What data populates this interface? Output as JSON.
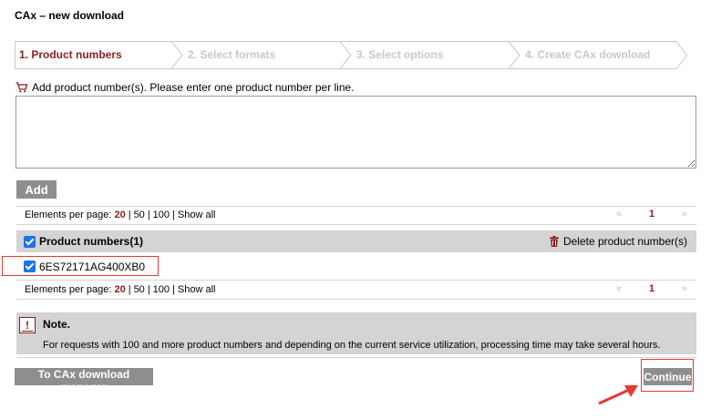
{
  "page": {
    "title": "CAx – new download"
  },
  "steps": [
    {
      "label": "1. Product numbers",
      "active": true
    },
    {
      "label": "2. Select formats",
      "active": false
    },
    {
      "label": "3. Select options",
      "active": false
    },
    {
      "label": "4. Create CAx download",
      "active": false
    }
  ],
  "entry": {
    "instruction": "Add product number(s). Please enter one product number per line.",
    "value": "",
    "add_label": "Add"
  },
  "pager": {
    "label": "Elements per page:",
    "options": [
      "20",
      "50",
      "100",
      "Show all"
    ],
    "selected": "20",
    "prev": "«",
    "current_page": "1",
    "next": "»"
  },
  "list": {
    "header_label": "Product numbers(1)",
    "delete_label": "Delete product number(s)",
    "items": [
      "6ES72171AG400XB0"
    ]
  },
  "note": {
    "title": "Note.",
    "text": "For requests with 100 and more product numbers and depending on the current service utilization, processing time may take several hours."
  },
  "footer": {
    "manager_label": "To CAx download manager",
    "continue_label": "Continue"
  },
  "colors": {
    "accent": "#8c1d1d",
    "button_gray": "#8e8e8e",
    "panel_gray": "#d4d4d4",
    "highlight_red": "#e53935"
  }
}
